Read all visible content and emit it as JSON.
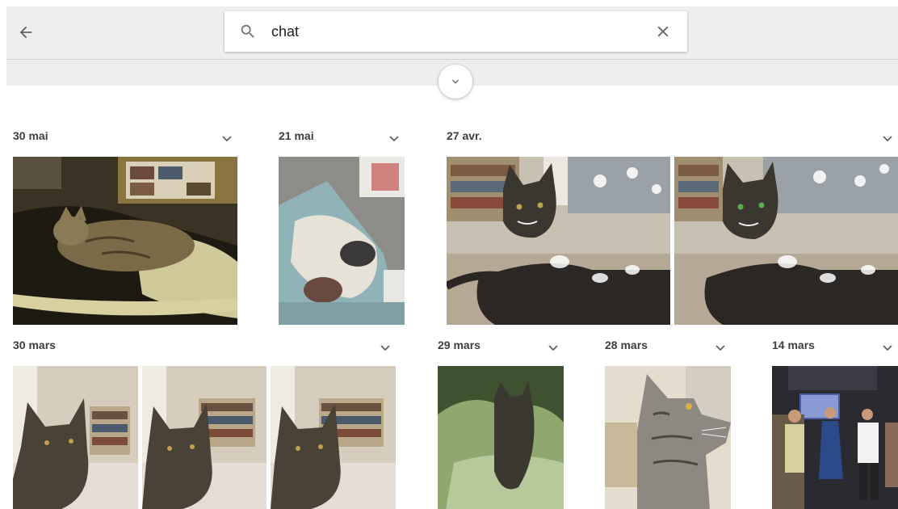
{
  "search": {
    "query": "chat",
    "placeholder": ""
  },
  "groups": [
    {
      "date": "30 mai",
      "photos": [
        "Chat endormi sur une couverture"
      ]
    },
    {
      "date": "21 mai",
      "photos": [
        "Personne et chat sur un canapé"
      ]
    },
    {
      "date": "27 avr.",
      "photos": [
        "Chat tigré allongé",
        "Chat tigré allongé"
      ]
    },
    {
      "date": "30 mars",
      "photos": [
        "Chat tigré",
        "Chat tigré",
        "Chat tigré"
      ]
    },
    {
      "date": "29 mars",
      "photos": [
        "Chat flou dans un fauteuil"
      ]
    },
    {
      "date": "28 mars",
      "photos": [
        "Chat de profil"
      ]
    },
    {
      "date": "14 mars",
      "photos": [
        "Groupe de personnes"
      ]
    }
  ],
  "colors": {
    "topbar": "#eeeeee",
    "icon": "#5f6368",
    "label": "#3c4043"
  },
  "icons": {
    "back": "arrow-back-icon",
    "search": "search-icon",
    "clear": "close-icon",
    "expand": "chevron-down-icon"
  }
}
